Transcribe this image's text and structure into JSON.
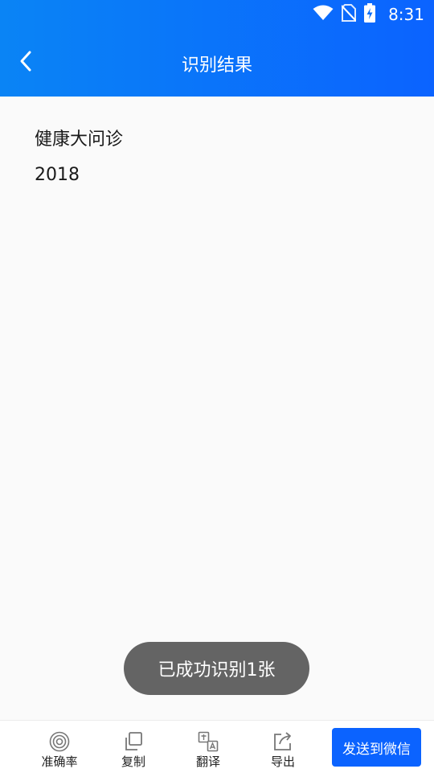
{
  "status_bar": {
    "time": "8:31"
  },
  "header": {
    "title": "识别结果"
  },
  "result": {
    "lines": [
      "健康大问诊",
      "2018"
    ]
  },
  "toast": {
    "message": "已成功识别1张"
  },
  "toolbar": {
    "accuracy_label": "准确率",
    "copy_label": "复制",
    "translate_label": "翻译",
    "export_label": "导出",
    "send_label": "发送到微信"
  },
  "colors": {
    "primary": "#0b63ff",
    "toast_bg": "#646464"
  }
}
